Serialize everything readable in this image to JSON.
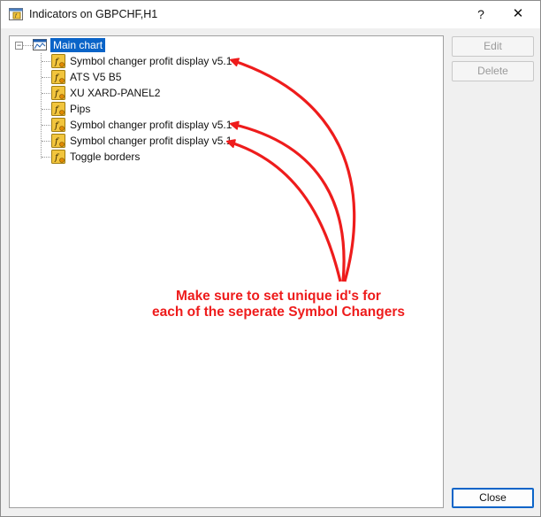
{
  "window": {
    "title": "Indicators on GBPCHF,H1",
    "help_label": "?",
    "close_label": "✕"
  },
  "tree": {
    "root_label": "Main chart",
    "items": [
      {
        "label": "Symbol changer profit display v5.1"
      },
      {
        "label": "ATS V5 B5"
      },
      {
        "label": "XU XARD-PANEL2"
      },
      {
        "label": "Pips"
      },
      {
        "label": "Symbol changer profit display v5.1"
      },
      {
        "label": "Symbol changer profit display v5.1"
      },
      {
        "label": "Toggle borders"
      }
    ]
  },
  "buttons": {
    "edit": "Edit",
    "delete": "Delete",
    "close": "Close"
  },
  "annotation": {
    "line1": "Make sure to set unique id's for",
    "line2": "each of the seperate Symbol Changers",
    "color": "#ee1c1c"
  },
  "colors": {
    "selection": "#0a64c8",
    "icon_bg": "#f2c53d"
  }
}
